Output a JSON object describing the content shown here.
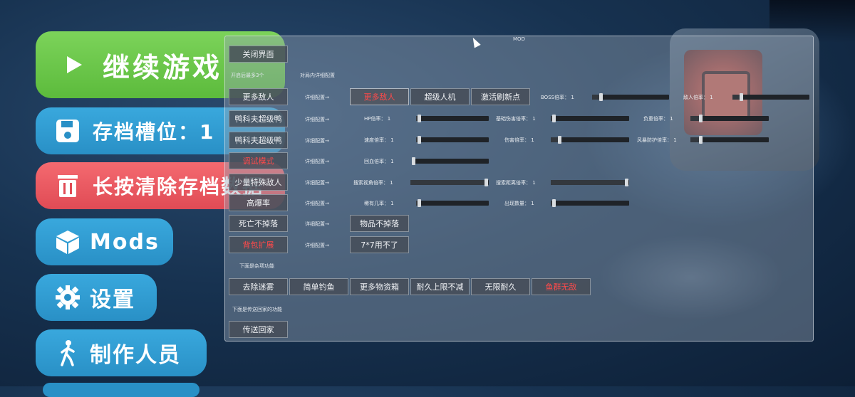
{
  "main_menu": {
    "continue": "继续游戏",
    "save_slot": "存档槽位：1",
    "delete_save": "长按清除存档数据",
    "mods": "Mods",
    "settings": "设置",
    "credits": "制作人员"
  },
  "mod_panel": {
    "title": "MOD",
    "close": "关闭界面",
    "section_top": "开启后最多3个",
    "section_top2": "对局内详细配置",
    "detail_config": "详细配置→",
    "rows": [
      {
        "button": "更多敌人",
        "button_red": false
      },
      {
        "button": "鸭科夫超级鸭",
        "button_red": false
      },
      {
        "button": "鸭科夫超级鸭",
        "button_red": false
      },
      {
        "button": "调试模式",
        "button_red": true
      },
      {
        "button": "少量特殊敌人",
        "button_red": false
      },
      {
        "button": "高爆率",
        "button_red": false
      },
      {
        "button": "死亡不掉落",
        "button_red": false
      },
      {
        "button": "背包扩展",
        "button_red": true
      }
    ],
    "row0_buttons": [
      "更多敌人",
      "超级人机",
      "激活刷新点"
    ],
    "row6_button": "物品不掉落",
    "row7_button": "7*7用不了",
    "sliders": {
      "boss": {
        "label": "BOSS倍率：",
        "value": "1"
      },
      "enemy": {
        "label": "敌人倍率：",
        "value": "1"
      },
      "hp": {
        "label": "HP倍率：",
        "value": "1"
      },
      "base_dmg": {
        "label": "基础伤害倍率：",
        "value": "1"
      },
      "weight": {
        "label": "负重倍率：",
        "value": "1"
      },
      "speed": {
        "label": "速度倍率：",
        "value": "1"
      },
      "damage": {
        "label": "伤害倍率：",
        "value": "1"
      },
      "storm": {
        "label": "风暴防护倍率：",
        "value": "1"
      },
      "regen": {
        "label": "回血倍率：",
        "value": "1"
      },
      "search_angle": {
        "label": "搜索视角倍率：",
        "value": "1"
      },
      "search_dist": {
        "label": "搜索距离倍率：",
        "value": "1"
      },
      "rare": {
        "label": "稀有几率：",
        "value": "1"
      },
      "spawn_count": {
        "label": "出现数量：",
        "value": "1"
      }
    },
    "section_bottom": "下面是杂项功能",
    "bottom_buttons": [
      "去除迷雾",
      "简单钓鱼",
      "更多物资箱",
      "耐久上限不减",
      "无限耐久",
      "鱼群无敌"
    ],
    "section_teleport": "下面是传送回家的功能",
    "teleport": "传送回家"
  },
  "colors": {
    "continue": "#6cc84a",
    "save": "#2f9dd3",
    "delete": "#eb5a63"
  }
}
